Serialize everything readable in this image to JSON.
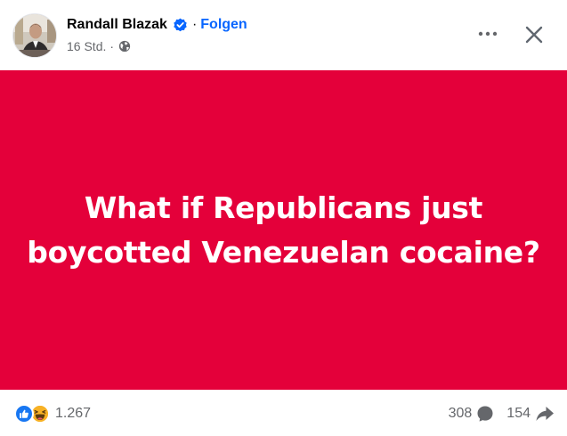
{
  "header": {
    "author": "Randall Blazak",
    "separator": "·",
    "follow": "Folgen",
    "timestamp": "16 Std.",
    "meta_separator": "·",
    "audience_icon": "globe-icon",
    "verified_icon": "verified-badge-icon",
    "more_icon": "more-horizontal-icon",
    "close_icon": "close-icon"
  },
  "post": {
    "text": "What if Republicans just boycotted Venezuelan cocaine?",
    "background_color": "#e4003a",
    "text_color": "#ffffff"
  },
  "footer": {
    "reactions": [
      "like-reaction-icon",
      "haha-reaction-icon"
    ],
    "reaction_count": "1.267",
    "comments": "308",
    "comment_icon": "comment-icon",
    "shares": "154",
    "share_icon": "share-icon"
  },
  "colors": {
    "accent": "#0866ff",
    "secondary_text": "#65676b"
  }
}
